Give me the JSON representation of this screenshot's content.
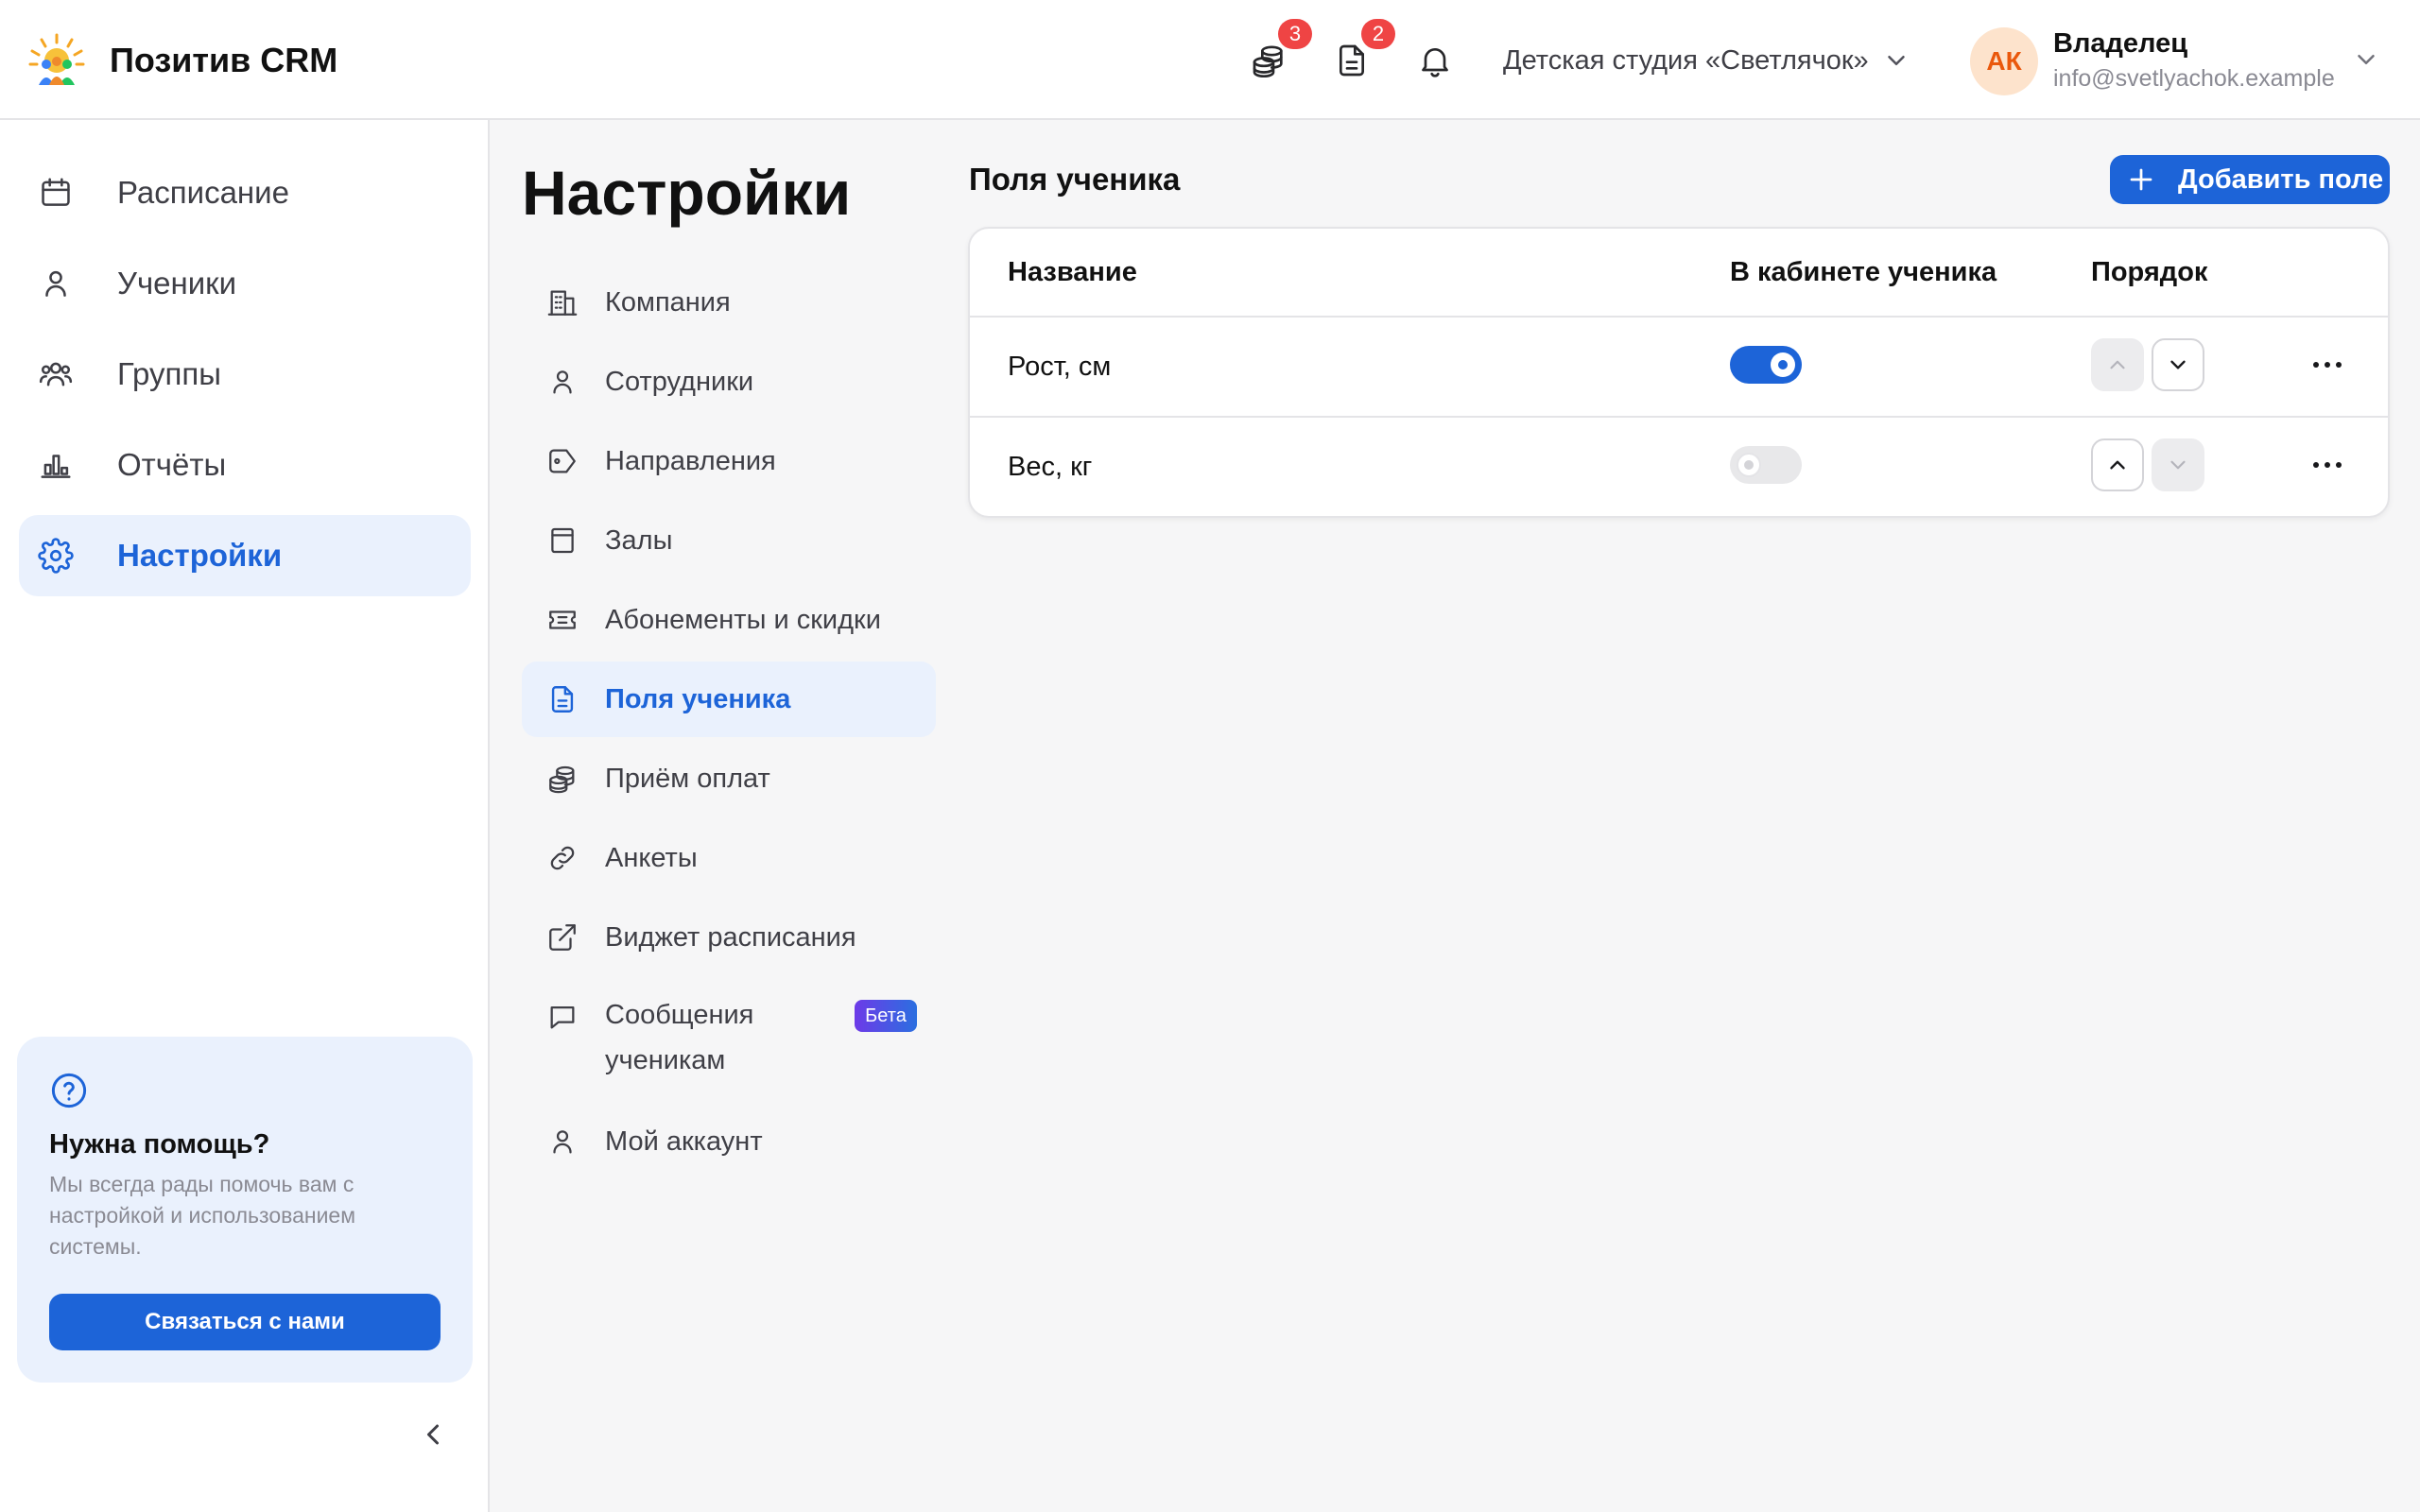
{
  "header": {
    "brand": "Позитив CRM",
    "payments_badge": "3",
    "documents_badge": "2",
    "organization": "Детская студия «Светлячок»",
    "user": {
      "initials": "АК",
      "role": "Владелец",
      "email": "info@svetlyachok.example"
    }
  },
  "sidebar": {
    "items": [
      {
        "label": "Расписание",
        "icon": "calendar-icon"
      },
      {
        "label": "Ученики",
        "icon": "user-icon"
      },
      {
        "label": "Группы",
        "icon": "users-icon"
      },
      {
        "label": "Отчёты",
        "icon": "chart-icon"
      },
      {
        "label": "Настройки",
        "icon": "gear-icon",
        "active": true
      }
    ],
    "help": {
      "title": "Нужна помощь?",
      "text": "Мы всегда рады помочь вам с настройкой и использованием системы.",
      "button": "Связаться с нами"
    }
  },
  "settings": {
    "title": "Настройки",
    "menu": [
      {
        "label": "Компания",
        "icon": "building-icon"
      },
      {
        "label": "Сотрудники",
        "icon": "user-icon"
      },
      {
        "label": "Направления",
        "icon": "tag-icon"
      },
      {
        "label": "Залы",
        "icon": "door-icon"
      },
      {
        "label": "Абонементы и скидки",
        "icon": "ticket-icon"
      },
      {
        "label": "Поля ученика",
        "icon": "document-icon",
        "active": true
      },
      {
        "label": "Приём оплат",
        "icon": "coins-icon"
      },
      {
        "label": "Анкеты",
        "icon": "link-icon"
      },
      {
        "label": "Виджет расписания",
        "icon": "external-link-icon"
      },
      {
        "label": "Сообщения ученикам",
        "icon": "message-icon",
        "badge": "Бета"
      },
      {
        "label": "Мой аккаунт",
        "icon": "user-icon"
      }
    ]
  },
  "content": {
    "section_title": "Поля ученика",
    "add_button": "Добавить поле",
    "table": {
      "columns": [
        "Название",
        "В кабинете ученика",
        "Порядок"
      ],
      "rows": [
        {
          "name": "Рост, см",
          "in_cabinet": true,
          "can_move_up": false,
          "can_move_down": true
        },
        {
          "name": "Вес, кг",
          "in_cabinet": false,
          "can_move_up": true,
          "can_move_down": false
        }
      ]
    }
  },
  "colors": {
    "accent": "#1d64d8",
    "accent_light": "#eaf1fd",
    "badge_red": "#ef4444",
    "avatar_bg": "#fde3cc",
    "avatar_text": "#ea580c"
  }
}
